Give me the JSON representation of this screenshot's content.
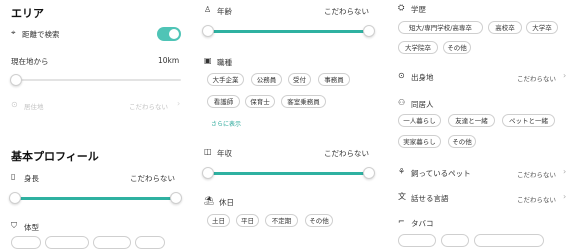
{
  "left": {
    "area_title": "エリア",
    "distance_search": "距離で検索",
    "from_location": "現在地から",
    "distance": "10km",
    "residence": "居住地",
    "residence_value": "こだわらない",
    "profile_title": "基本プロフィール",
    "height": "身長",
    "height_value": "こだわらない",
    "body_type": "体型"
  },
  "middle": {
    "age": "年齢",
    "age_value": "こだわらない",
    "occupation": "職種",
    "occupation_chips": [
      "大手企業",
      "公務員",
      "受付",
      "事務員",
      "看護師",
      "保育士",
      "客室乗務員"
    ],
    "show_more": "さらに表示",
    "income": "年収",
    "income_value": "こだわらない",
    "holiday": "休日",
    "holiday_chips": [
      "土日",
      "平日",
      "不定期",
      "その他"
    ]
  },
  "right": {
    "education": "学歴",
    "education_chips": [
      "短大/専門学校/高専卒",
      "高校卒",
      "大学卒",
      "大学院卒",
      "その他"
    ],
    "hometown": "出身地",
    "hometown_value": "こだわらない",
    "cohabitant": "同居人",
    "cohabitant_chips": [
      "一人暮らし",
      "友達と一緒",
      "ペットと一緒",
      "実家暮らし",
      "その他"
    ],
    "pets": "飼っているペット",
    "pets_value": "こだわらない",
    "language": "話せる言語",
    "language_value": "こだわらない",
    "tobacco": "タバコ"
  },
  "colors": {
    "accent": "#2fb1a1",
    "toggle": "#4fc4b6"
  }
}
